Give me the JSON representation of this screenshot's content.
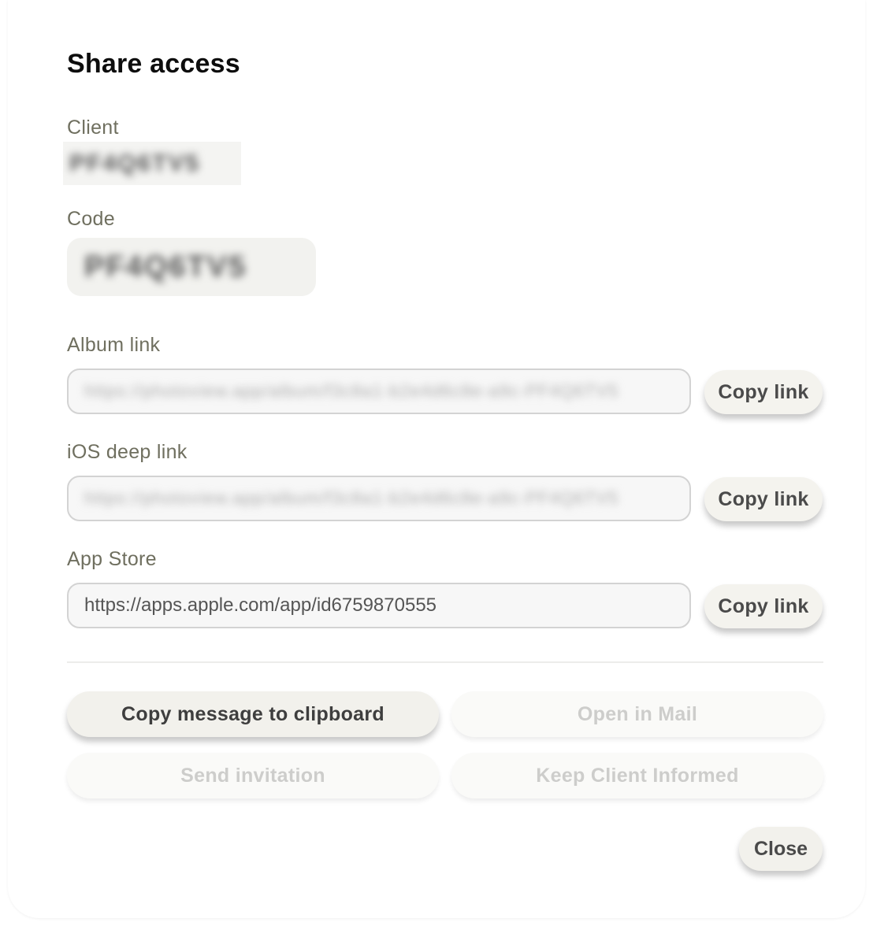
{
  "dialog": {
    "title": "Share access"
  },
  "client": {
    "label": "Client",
    "value": "PF4Q6TV5"
  },
  "code": {
    "label": "Code",
    "value": "PF4Q6TV5"
  },
  "album_link": {
    "label": "Album link",
    "value": "https://photoview.app/album/f3c8a1-b2e4d6c8e-a9c-PF4Q6TV5",
    "copy_label": "Copy link"
  },
  "ios_deep_link": {
    "label": "iOS deep link",
    "value": "https://photoview.app/album/f3c8a1-b2e4d6c8e-a9c-PF4Q6TV5",
    "copy_label": "Copy link"
  },
  "app_store": {
    "label": "App Store",
    "value": "https://apps.apple.com/app/id6759870555",
    "copy_label": "Copy link"
  },
  "actions": {
    "copy_message": "Copy message to clipboard",
    "open_mail": "Open in Mail",
    "send_invitation": "Send invitation",
    "keep_informed": "Keep Client Informed"
  },
  "footer": {
    "close_label": "Close"
  }
}
